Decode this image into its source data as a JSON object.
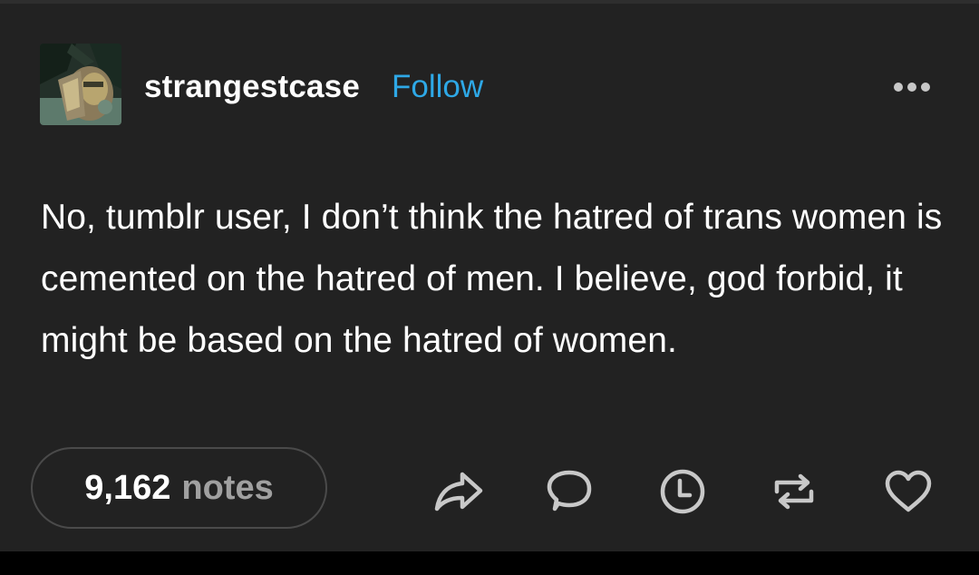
{
  "post": {
    "username": "strangestcase",
    "follow_label": "Follow",
    "text": "No, tumblr user, I don’t think the hatred of trans women is cemented on the hatred of men. I believe, god forbid, it might be based on the hatred of women.",
    "notes_count": "9,162",
    "notes_label": "notes"
  },
  "icons": {
    "more": "more-options-icon",
    "share": "share-icon",
    "reply": "reply-icon",
    "queue": "clock-icon",
    "reblog": "reblog-icon",
    "like": "heart-icon"
  },
  "colors": {
    "background": "#222222",
    "text": "#ffffff",
    "follow": "#2ea8e6",
    "muted": "#a0a0a0"
  }
}
